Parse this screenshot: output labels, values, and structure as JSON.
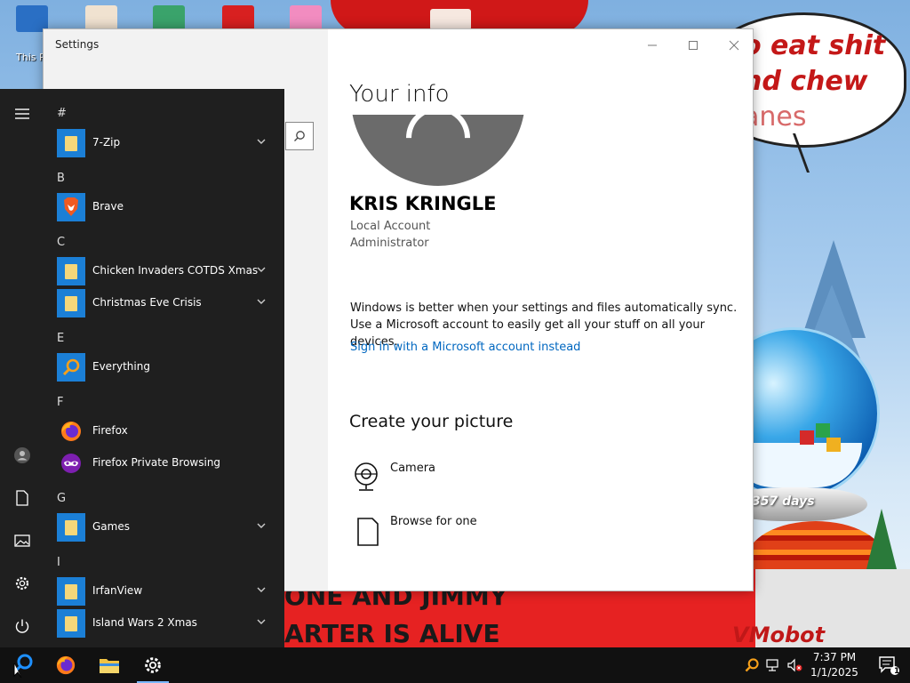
{
  "desktop": {
    "icon_label": "This P",
    "speech_lines": [
      "o eat shit",
      "nd chew",
      "anes"
    ],
    "banner_lines": [
      "ONE AND JIMMY",
      "ARTER IS ALIVE"
    ],
    "snowglobe_text": "357 days",
    "watermark": "VMobot"
  },
  "settings": {
    "title": "Settings",
    "heading": "Your info",
    "user_name": "KRIS KRINGLE",
    "account_type": "Local Account",
    "role": "Administrator",
    "sync_text": "Windows is better when your settings and files automatically sync. Use a Microsoft account to easily get all your stuff on all your devices.",
    "sign_in_link": "Sign in with a Microsoft account instead",
    "create_heading": "Create your picture",
    "options": [
      {
        "label": "Camera",
        "icon": "camera-icon"
      },
      {
        "label": "Browse for one",
        "icon": "file-icon"
      }
    ],
    "accent": "#0067c0"
  },
  "start_menu": {
    "letters": [
      "#",
      "B",
      "C",
      "E",
      "F",
      "G",
      "I"
    ],
    "apps": [
      {
        "name": "7-Zip",
        "icon": "folder-icon",
        "expandable": true
      },
      {
        "name": "Brave",
        "icon": "brave-icon",
        "expandable": false
      },
      {
        "name": "Chicken Invaders COTDS Xmas",
        "icon": "folder-icon",
        "expandable": true
      },
      {
        "name": "Christmas Eve Crisis",
        "icon": "folder-icon",
        "expandable": true
      },
      {
        "name": "Everything",
        "icon": "search-icon",
        "expandable": false
      },
      {
        "name": "Firefox",
        "icon": "firefox-icon",
        "expandable": false
      },
      {
        "name": "Firefox Private Browsing",
        "icon": "private-browsing-icon",
        "expandable": false
      },
      {
        "name": "Games",
        "icon": "folder-icon",
        "expandable": true
      },
      {
        "name": "IrfanView",
        "icon": "folder-icon",
        "expandable": true
      },
      {
        "name": "Island Wars 2 Xmas",
        "icon": "folder-icon",
        "expandable": true
      }
    ]
  },
  "taskbar": {
    "time": "7:37 PM",
    "date": "1/1/2025",
    "notification_count": "1"
  }
}
